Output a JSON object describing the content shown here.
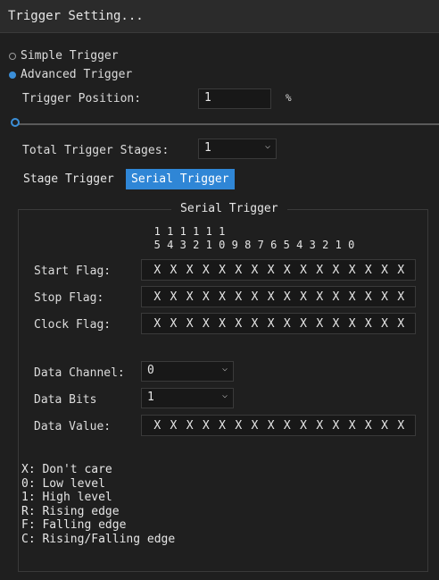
{
  "window": {
    "title": "Trigger Setting..."
  },
  "mode": {
    "simple_label": "Simple Trigger",
    "advanced_label": "Advanced Trigger",
    "selected": "advanced"
  },
  "trigger_position": {
    "label": "Trigger Position:",
    "value": "1",
    "unit": "%",
    "slider_fraction": 0.01
  },
  "stages": {
    "label": "Total Trigger Stages:",
    "value": "1"
  },
  "tabs": [
    {
      "label": "Stage Trigger",
      "active": false
    },
    {
      "label": "Serial Trigger",
      "active": true
    }
  ],
  "serial": {
    "title": "Serial Trigger",
    "bit_tens": [
      "1",
      "1",
      "1",
      "1",
      "1",
      "1",
      "",
      "",
      "",
      "",
      "",
      "",
      "",
      "",
      "",
      ""
    ],
    "bit_ones": [
      "5",
      "4",
      "3",
      "2",
      "1",
      "0",
      "9",
      "8",
      "7",
      "6",
      "5",
      "4",
      "3",
      "2",
      "1",
      "0"
    ],
    "start_flag": {
      "label": "Start Flag:",
      "bits": [
        "X",
        "X",
        "X",
        "X",
        "X",
        "X",
        "X",
        "X",
        "X",
        "X",
        "X",
        "X",
        "X",
        "X",
        "X",
        "X"
      ]
    },
    "stop_flag": {
      "label": "Stop Flag:",
      "bits": [
        "X",
        "X",
        "X",
        "X",
        "X",
        "X",
        "X",
        "X",
        "X",
        "X",
        "X",
        "X",
        "X",
        "X",
        "X",
        "X"
      ]
    },
    "clock_flag": {
      "label": "Clock Flag:",
      "bits": [
        "X",
        "X",
        "X",
        "X",
        "X",
        "X",
        "X",
        "X",
        "X",
        "X",
        "X",
        "X",
        "X",
        "X",
        "X",
        "X"
      ]
    },
    "data_channel": {
      "label": "Data Channel:",
      "value": "0"
    },
    "data_bits": {
      "label": "Data Bits",
      "value": "1"
    },
    "data_value": {
      "label": "Data Value:",
      "bits": [
        "X",
        "X",
        "X",
        "X",
        "X",
        "X",
        "X",
        "X",
        "X",
        "X",
        "X",
        "X",
        "X",
        "X",
        "X",
        "X"
      ]
    }
  },
  "legend": [
    "X: Don't care",
    "0: Low level",
    "1: High level",
    "R: Rising edge",
    "F: Falling edge",
    "C: Rising/Falling edge"
  ],
  "colors": {
    "accent": "#2f86d6",
    "background": "#1f1f1f",
    "field": "#181818"
  }
}
